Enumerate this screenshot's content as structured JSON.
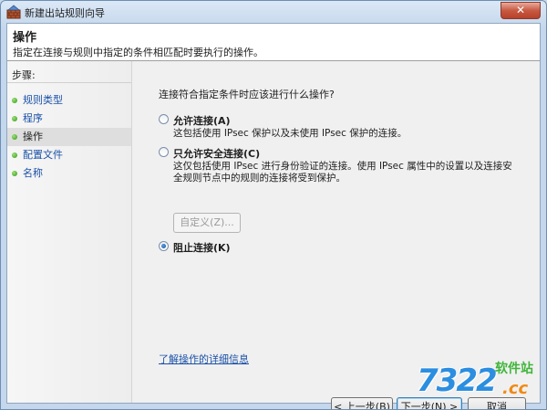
{
  "window": {
    "title": "新建出站规则向导",
    "close_symbol": "✕"
  },
  "header": {
    "title": "操作",
    "description": "指定在连接与规则中指定的条件相匹配时要执行的操作。"
  },
  "steps": {
    "heading": "步骤:",
    "items": [
      {
        "label": "规则类型",
        "active": false
      },
      {
        "label": "程序",
        "active": false
      },
      {
        "label": "操作",
        "active": true
      },
      {
        "label": "配置文件",
        "active": false
      },
      {
        "label": "名称",
        "active": false
      }
    ]
  },
  "main": {
    "question": "连接符合指定条件时应该进行什么操作?",
    "options": [
      {
        "label": "允许连接(A)",
        "description": [
          "这包括使用 IPsec 保护以及未使用 IPsec 保护的连接。"
        ],
        "selected": false
      },
      {
        "label": "只允许安全连接(C)",
        "description": [
          "这仅包括使用 IPsec 进行身份验证的连接。使用 IPsec 属性中的设置以及连接安",
          "全规则节点中的规则的连接将受到保护。"
        ],
        "selected": false
      },
      {
        "label": "阻止连接(K)",
        "description": [],
        "selected": true
      }
    ],
    "customize_button": "自定义(Z)...",
    "learn_more_link": "了解操作的详细信息"
  },
  "footer": {
    "back_button": "< 上一步(B)",
    "next_button": "下一步(N) >",
    "cancel_button": "取消"
  },
  "watermark": {
    "digits": "7322",
    "site": "软件站",
    "suffix": ".cc"
  }
}
